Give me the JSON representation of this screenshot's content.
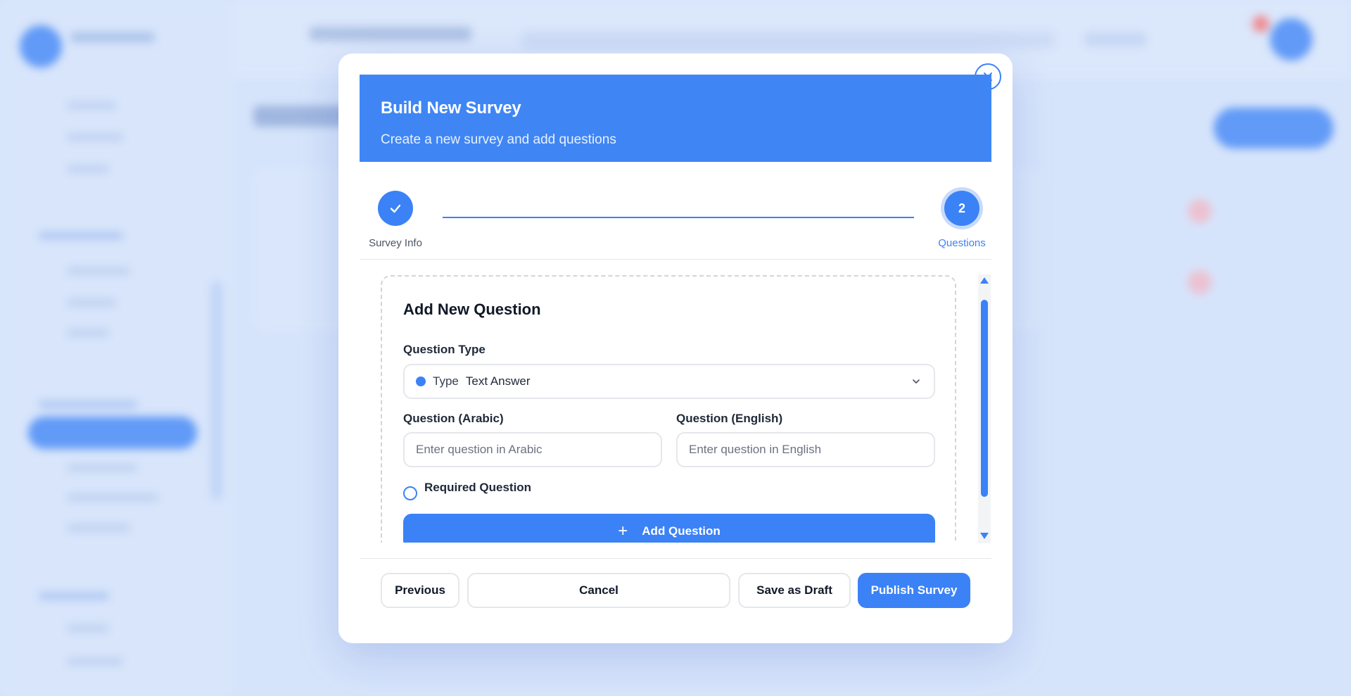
{
  "modal": {
    "title": "Build New Survey",
    "subtitle": "Create a new survey and add questions"
  },
  "stepper": {
    "steps": [
      {
        "number": "",
        "label": "Survey Info",
        "status": "completed"
      },
      {
        "number": "2",
        "label": "Questions",
        "status": "active"
      }
    ]
  },
  "question_form": {
    "title": "Add New Question",
    "type_label": "Question Type",
    "type_prefix": "Type",
    "type_value": "Text Answer",
    "arabic_label": "Question (Arabic)",
    "arabic_placeholder": "Enter question in Arabic",
    "english_label": "Question (English)",
    "english_placeholder": "Enter question in English",
    "required_label": "Required Question",
    "add_button_label": "Add Question"
  },
  "footer": {
    "previous_label": "Previous",
    "cancel_label": "Cancel",
    "draft_label": "Save as Draft",
    "publish_label": "Publish Survey"
  },
  "icons": {
    "close": "close-icon",
    "check": "check-icon",
    "chevron": "chevron-down-icon",
    "plus": "plus-icon"
  },
  "colors": {
    "primary": "#3b82f6",
    "header": "#3f86f4",
    "background": "#d6e4fb"
  }
}
